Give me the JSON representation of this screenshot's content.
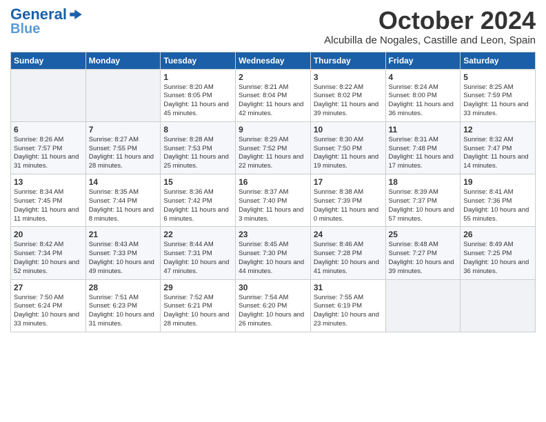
{
  "header": {
    "logo": {
      "line1": "General",
      "line2": "Blue"
    },
    "title": "October 2024",
    "location": "Alcubilla de Nogales, Castille and Leon, Spain"
  },
  "calendar": {
    "weekdays": [
      "Sunday",
      "Monday",
      "Tuesday",
      "Wednesday",
      "Thursday",
      "Friday",
      "Saturday"
    ],
    "weeks": [
      [
        {
          "day": "",
          "info": ""
        },
        {
          "day": "",
          "info": ""
        },
        {
          "day": "1",
          "info": "Sunrise: 8:20 AM\nSunset: 8:05 PM\nDaylight: 11 hours and 45 minutes."
        },
        {
          "day": "2",
          "info": "Sunrise: 8:21 AM\nSunset: 8:04 PM\nDaylight: 11 hours and 42 minutes."
        },
        {
          "day": "3",
          "info": "Sunrise: 8:22 AM\nSunset: 8:02 PM\nDaylight: 11 hours and 39 minutes."
        },
        {
          "day": "4",
          "info": "Sunrise: 8:24 AM\nSunset: 8:00 PM\nDaylight: 11 hours and 36 minutes."
        },
        {
          "day": "5",
          "info": "Sunrise: 8:25 AM\nSunset: 7:59 PM\nDaylight: 11 hours and 33 minutes."
        }
      ],
      [
        {
          "day": "6",
          "info": "Sunrise: 8:26 AM\nSunset: 7:57 PM\nDaylight: 11 hours and 31 minutes."
        },
        {
          "day": "7",
          "info": "Sunrise: 8:27 AM\nSunset: 7:55 PM\nDaylight: 11 hours and 28 minutes."
        },
        {
          "day": "8",
          "info": "Sunrise: 8:28 AM\nSunset: 7:53 PM\nDaylight: 11 hours and 25 minutes."
        },
        {
          "day": "9",
          "info": "Sunrise: 8:29 AM\nSunset: 7:52 PM\nDaylight: 11 hours and 22 minutes."
        },
        {
          "day": "10",
          "info": "Sunrise: 8:30 AM\nSunset: 7:50 PM\nDaylight: 11 hours and 19 minutes."
        },
        {
          "day": "11",
          "info": "Sunrise: 8:31 AM\nSunset: 7:48 PM\nDaylight: 11 hours and 17 minutes."
        },
        {
          "day": "12",
          "info": "Sunrise: 8:32 AM\nSunset: 7:47 PM\nDaylight: 11 hours and 14 minutes."
        }
      ],
      [
        {
          "day": "13",
          "info": "Sunrise: 8:34 AM\nSunset: 7:45 PM\nDaylight: 11 hours and 11 minutes."
        },
        {
          "day": "14",
          "info": "Sunrise: 8:35 AM\nSunset: 7:44 PM\nDaylight: 11 hours and 8 minutes."
        },
        {
          "day": "15",
          "info": "Sunrise: 8:36 AM\nSunset: 7:42 PM\nDaylight: 11 hours and 6 minutes."
        },
        {
          "day": "16",
          "info": "Sunrise: 8:37 AM\nSunset: 7:40 PM\nDaylight: 11 hours and 3 minutes."
        },
        {
          "day": "17",
          "info": "Sunrise: 8:38 AM\nSunset: 7:39 PM\nDaylight: 11 hours and 0 minutes."
        },
        {
          "day": "18",
          "info": "Sunrise: 8:39 AM\nSunset: 7:37 PM\nDaylight: 10 hours and 57 minutes."
        },
        {
          "day": "19",
          "info": "Sunrise: 8:41 AM\nSunset: 7:36 PM\nDaylight: 10 hours and 55 minutes."
        }
      ],
      [
        {
          "day": "20",
          "info": "Sunrise: 8:42 AM\nSunset: 7:34 PM\nDaylight: 10 hours and 52 minutes."
        },
        {
          "day": "21",
          "info": "Sunrise: 8:43 AM\nSunset: 7:33 PM\nDaylight: 10 hours and 49 minutes."
        },
        {
          "day": "22",
          "info": "Sunrise: 8:44 AM\nSunset: 7:31 PM\nDaylight: 10 hours and 47 minutes."
        },
        {
          "day": "23",
          "info": "Sunrise: 8:45 AM\nSunset: 7:30 PM\nDaylight: 10 hours and 44 minutes."
        },
        {
          "day": "24",
          "info": "Sunrise: 8:46 AM\nSunset: 7:28 PM\nDaylight: 10 hours and 41 minutes."
        },
        {
          "day": "25",
          "info": "Sunrise: 8:48 AM\nSunset: 7:27 PM\nDaylight: 10 hours and 39 minutes."
        },
        {
          "day": "26",
          "info": "Sunrise: 8:49 AM\nSunset: 7:25 PM\nDaylight: 10 hours and 36 minutes."
        }
      ],
      [
        {
          "day": "27",
          "info": "Sunrise: 7:50 AM\nSunset: 6:24 PM\nDaylight: 10 hours and 33 minutes."
        },
        {
          "day": "28",
          "info": "Sunrise: 7:51 AM\nSunset: 6:23 PM\nDaylight: 10 hours and 31 minutes."
        },
        {
          "day": "29",
          "info": "Sunrise: 7:52 AM\nSunset: 6:21 PM\nDaylight: 10 hours and 28 minutes."
        },
        {
          "day": "30",
          "info": "Sunrise: 7:54 AM\nSunset: 6:20 PM\nDaylight: 10 hours and 26 minutes."
        },
        {
          "day": "31",
          "info": "Sunrise: 7:55 AM\nSunset: 6:19 PM\nDaylight: 10 hours and 23 minutes."
        },
        {
          "day": "",
          "info": ""
        },
        {
          "day": "",
          "info": ""
        }
      ]
    ]
  }
}
